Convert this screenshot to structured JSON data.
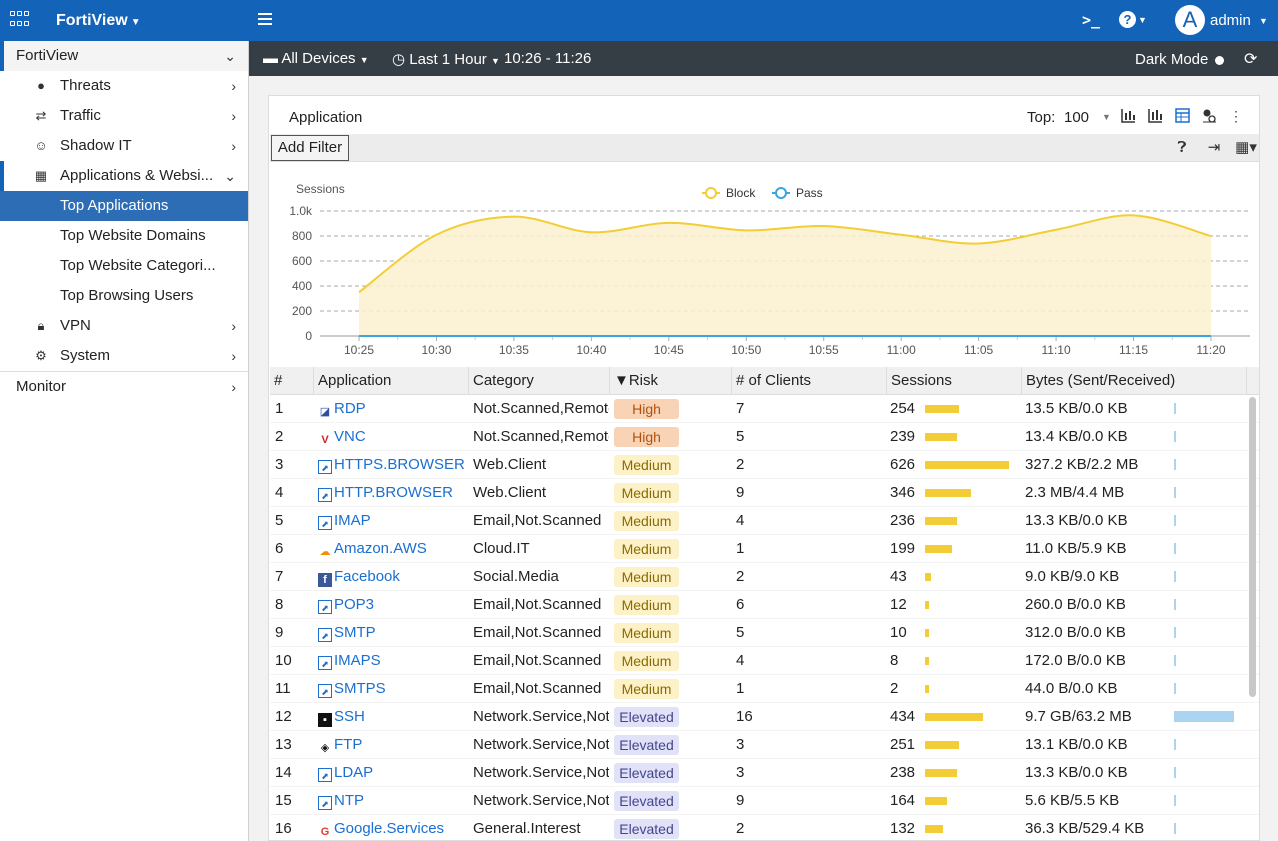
{
  "topbar": {
    "brand": "FortiView",
    "user": "admin",
    "avatar_letter": "A",
    "cli_label": ">_",
    "help_label": "?"
  },
  "sidebar": {
    "top": "FortiView",
    "items": [
      {
        "label": "Threats",
        "icon": "droplet-icon"
      },
      {
        "label": "Traffic",
        "icon": "arrows-exchange-icon"
      },
      {
        "label": "Shadow IT",
        "icon": "spy-icon"
      },
      {
        "label": "Applications & Websi...",
        "icon": "grid-icon"
      }
    ],
    "subitems": [
      "Top Applications",
      "Top Website Domains",
      "Top Website Categori...",
      "Top Browsing Users"
    ],
    "items2": [
      {
        "label": "VPN",
        "icon": "lock-icon"
      },
      {
        "label": "System",
        "icon": "gear-icon"
      }
    ],
    "monitor": "Monitor"
  },
  "toolbar": {
    "devices": "All Devices",
    "time": "Last 1 Hour",
    "range": "10:26 - 11:26",
    "dark_mode": "Dark Mode"
  },
  "panel": {
    "title": "Application",
    "top_label": "Top:",
    "top_value": "100",
    "add_filter": "Add Filter"
  },
  "chart_data": {
    "type": "area",
    "ylabel": "Sessions",
    "ylim": [
      0,
      1000
    ],
    "yticks": [
      "0",
      "200",
      "400",
      "600",
      "800",
      "1.0k"
    ],
    "x": [
      "10:25",
      "10:30",
      "10:35",
      "10:40",
      "10:45",
      "10:50",
      "10:55",
      "11:00",
      "11:05",
      "11:10",
      "11:15",
      "11:20"
    ],
    "legend_position": "top-center",
    "grid": true,
    "series": [
      {
        "name": "Block",
        "color": "#f2cd35",
        "values": [
          350,
          810,
          955,
          830,
          905,
          845,
          880,
          810,
          740,
          850,
          965,
          800
        ]
      },
      {
        "name": "Pass",
        "color": "#3aa3e3",
        "values": [
          0,
          0,
          0,
          0,
          0,
          0,
          0,
          0,
          0,
          0,
          0,
          0
        ]
      }
    ]
  },
  "table": {
    "headers": [
      "#",
      "Application",
      "Category",
      "▼Risk",
      "# of Clients",
      "Sessions",
      "Bytes (Sent/Received)"
    ],
    "rows": [
      {
        "n": "1",
        "app": "RDP",
        "icon": "rdp-icon",
        "cat": "Not.Scanned,Remote",
        "risk": "High",
        "clients": "7",
        "sessions": "254",
        "bytes": "13.5 KB/0.0 KB"
      },
      {
        "n": "2",
        "app": "VNC",
        "icon": "vnc-icon",
        "cat": "Not.Scanned,Remote",
        "risk": "High",
        "clients": "5",
        "sessions": "239",
        "bytes": "13.4 KB/0.0 KB"
      },
      {
        "n": "3",
        "app": "HTTPS.BROWSER",
        "icon": "app-link-icon",
        "cat": "Web.Client",
        "risk": "Medium",
        "clients": "2",
        "sessions": "626",
        "bytes": "327.2 KB/2.2 MB"
      },
      {
        "n": "4",
        "app": "HTTP.BROWSER",
        "icon": "app-link-icon",
        "cat": "Web.Client",
        "risk": "Medium",
        "clients": "9",
        "sessions": "346",
        "bytes": "2.3 MB/4.4 MB"
      },
      {
        "n": "5",
        "app": "IMAP",
        "icon": "app-link-icon",
        "cat": "Email,Not.Scanned",
        "risk": "Medium",
        "clients": "4",
        "sessions": "236",
        "bytes": "13.3 KB/0.0 KB"
      },
      {
        "n": "6",
        "app": "Amazon.AWS",
        "icon": "aws-icon",
        "cat": "Cloud.IT",
        "risk": "Medium",
        "clients": "1",
        "sessions": "199",
        "bytes": "11.0 KB/5.9 KB"
      },
      {
        "n": "7",
        "app": "Facebook",
        "icon": "facebook-icon",
        "cat": "Social.Media",
        "risk": "Medium",
        "clients": "2",
        "sessions": "43",
        "bytes": "9.0 KB/9.0 KB"
      },
      {
        "n": "8",
        "app": "POP3",
        "icon": "app-link-icon",
        "cat": "Email,Not.Scanned",
        "risk": "Medium",
        "clients": "6",
        "sessions": "12",
        "bytes": "260.0 B/0.0 KB"
      },
      {
        "n": "9",
        "app": "SMTP",
        "icon": "app-link-icon",
        "cat": "Email,Not.Scanned",
        "risk": "Medium",
        "clients": "5",
        "sessions": "10",
        "bytes": "312.0 B/0.0 KB"
      },
      {
        "n": "10",
        "app": "IMAPS",
        "icon": "app-link-icon",
        "cat": "Email,Not.Scanned",
        "risk": "Medium",
        "clients": "4",
        "sessions": "8",
        "bytes": "172.0 B/0.0 KB"
      },
      {
        "n": "11",
        "app": "SMTPS",
        "icon": "app-link-icon",
        "cat": "Email,Not.Scanned",
        "risk": "Medium",
        "clients": "1",
        "sessions": "2",
        "bytes": "44.0 B/0.0 KB"
      },
      {
        "n": "12",
        "app": "SSH",
        "icon": "ssh-icon",
        "cat": "Network.Service,Not",
        "risk": "Elevated",
        "clients": "16",
        "sessions": "434",
        "bytes": "9.7 GB/63.2 MB"
      },
      {
        "n": "13",
        "app": "FTP",
        "icon": "ftp-icon",
        "cat": "Network.Service,Not",
        "risk": "Elevated",
        "clients": "3",
        "sessions": "251",
        "bytes": "13.1 KB/0.0 KB"
      },
      {
        "n": "14",
        "app": "LDAP",
        "icon": "app-link-icon",
        "cat": "Network.Service,Not",
        "risk": "Elevated",
        "clients": "3",
        "sessions": "238",
        "bytes": "13.3 KB/0.0 KB"
      },
      {
        "n": "15",
        "app": "NTP",
        "icon": "app-link-icon",
        "cat": "Network.Service,Not",
        "risk": "Elevated",
        "clients": "9",
        "sessions": "164",
        "bytes": "5.6 KB/5.5 KB"
      },
      {
        "n": "16",
        "app": "Google.Services",
        "icon": "google-icon",
        "cat": "General.Interest",
        "risk": "Elevated",
        "clients": "2",
        "sessions": "132",
        "bytes": "36.3 KB/529.4 KB"
      }
    ],
    "bytes_fraction": [
      0.01,
      0.01,
      0.02,
      0.02,
      0.01,
      0.01,
      0.02,
      0.01,
      0.01,
      0.01,
      0.01,
      1.0,
      0.01,
      0.01,
      0.02,
      0.02
    ]
  }
}
